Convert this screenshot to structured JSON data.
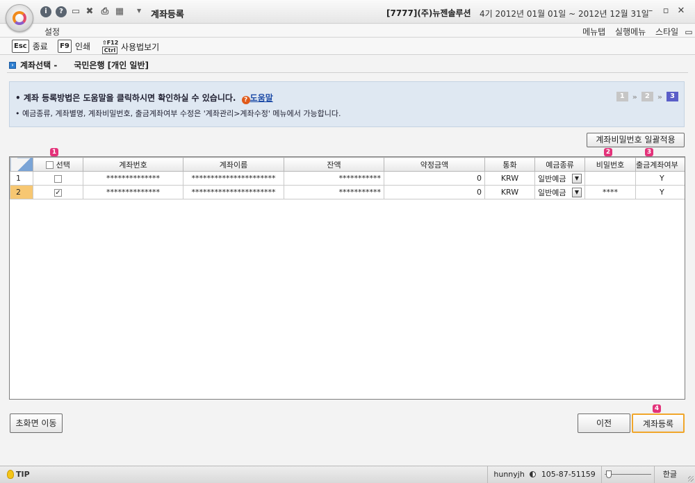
{
  "titlebar": {
    "quick_icons": [
      "info-icon",
      "help-icon",
      "monitor-icon",
      "close-x-icon",
      "printer-icon",
      "export-icon"
    ],
    "title": "계좌등록",
    "company": "[7777](주)뉴젠솔루션",
    "period": "4기 2012년 01월 01일 ~ 2012년 12월 31일"
  },
  "menubar": {
    "settings": "설정",
    "menu_tab": "메뉴탭",
    "run_menu": "실행메뉴",
    "style": "스타일"
  },
  "toolbar": {
    "close": {
      "key": "Esc",
      "label": "종료"
    },
    "print": {
      "key": "F9",
      "label": "인쇄"
    },
    "usage": {
      "key_top": "⇧F12",
      "key_bottom": "Ctrl",
      "label": "사용법보기"
    }
  },
  "header": {
    "label": "계좌선택 -",
    "bank": "국민은행 [개인 일반]"
  },
  "info": {
    "line1": "• 계좌 등록방법은 도움말을 클릭하시면 확인하실 수 있습니다.",
    "help_link": "도움말",
    "line2": "• 예금종류, 계좌별명, 계좌비밀번호, 출금계좌여부 수정은 '계좌관리>계좌수정' 메뉴에서 가능합니다.",
    "steps": [
      "1",
      "2",
      "3"
    ],
    "active_step": 3
  },
  "buttons": {
    "password_apply": "계좌비밀번호 일괄적용",
    "prev": "이전",
    "register": "계좌등록",
    "init": "초화면 이동"
  },
  "badges": {
    "select": "1",
    "password": "2",
    "withdraw": "3",
    "register": "4"
  },
  "table": {
    "columns": [
      "선택",
      "계좌번호",
      "계좌이름",
      "잔액",
      "약정금액",
      "통화",
      "예금종류",
      "비밀번호",
      "출금계좌여부"
    ],
    "rows": [
      {
        "num": "1",
        "checked": false,
        "account_no": "**************",
        "account_name": "**********************",
        "balance": "***********",
        "contract": "0",
        "currency": "KRW",
        "deposit_type": "일반예금",
        "password": "",
        "withdraw": "Y"
      },
      {
        "num": "2",
        "checked": true,
        "account_no": "**************",
        "account_name": "**********************",
        "balance": "***********",
        "contract": "0",
        "currency": "KRW",
        "deposit_type": "일반예금",
        "password": "****",
        "withdraw": "Y"
      }
    ]
  },
  "statusbar": {
    "tip": "TIP",
    "user": "hunnyjh",
    "biz_no": "105-87-51159",
    "lang": "한글"
  },
  "colors": {
    "info_bg": "#dfe8f2",
    "selected_row": "#f7c772",
    "badge": "#e3327a",
    "active_step": "#5a5ec8",
    "primary_button_border": "#f0a62a"
  }
}
